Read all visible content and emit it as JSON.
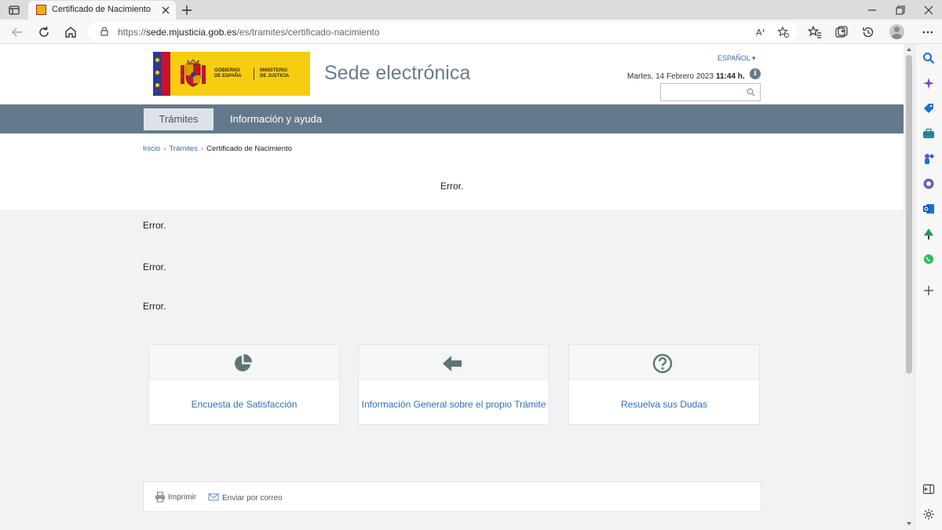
{
  "browser": {
    "tab_title": "Certificado de Nacimiento",
    "url_prefix": "https://",
    "url_domain": "sede.mjusticia.gob.es",
    "url_path": "/es/tramites/certificado-nacimiento"
  },
  "header": {
    "logo_left_line1": "GOBIERNO",
    "logo_left_line2": "DE ESPAÑA",
    "logo_right_line1": "MINISTERIO",
    "logo_right_line2": "DE JUSTICIA",
    "site_title": "Sede electrónica",
    "language": "ESPAÑOL ▾",
    "date": "Martes, 14 Febrero 2023",
    "time": "11:44 h.",
    "info_glyph": "i",
    "search_placeholder": ""
  },
  "nav": {
    "tabs": [
      {
        "label": "Trámites",
        "active": true
      },
      {
        "label": "Información y ayuda",
        "active": false
      }
    ]
  },
  "breadcrumb": {
    "items": [
      {
        "label": "Inicio",
        "link": true
      },
      {
        "label": "Trámites",
        "link": true
      },
      {
        "label": "Certificado de Nacimiento",
        "link": false
      }
    ],
    "separator": "›"
  },
  "main": {
    "center_error": "Error.",
    "errors": [
      "Error.",
      "Error.",
      "Error."
    ]
  },
  "cards": [
    {
      "label": "Encuesta de Satisfacción",
      "icon": "pie-chart-icon"
    },
    {
      "label": "Información General sobre el propio Trámite",
      "icon": "arrow-left-icon"
    },
    {
      "label": "Resuelva sus Dudas",
      "icon": "question-circle-icon"
    }
  ],
  "footer": {
    "print_label": "Imprimir",
    "email_label": "Enviar por correo"
  },
  "colors": {
    "nav_bg": "#647a8c",
    "link": "#2f6eb5",
    "logo_yellow": "#f7cd12",
    "icon_gray": "#5f7575"
  }
}
